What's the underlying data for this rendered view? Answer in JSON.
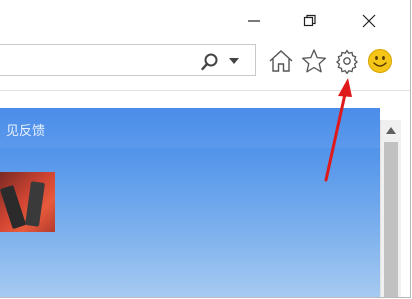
{
  "window": {
    "controls": [
      {
        "name": "minimize-icon"
      },
      {
        "name": "restore-icon"
      },
      {
        "name": "close-icon"
      }
    ]
  },
  "addressbar": {
    "icons": [
      "search-icon",
      "dropdown-caret-icon"
    ]
  },
  "toolbar": {
    "icons": [
      "home-icon",
      "favorites-star-icon",
      "settings-gear-icon",
      "feedback-smiley-icon"
    ],
    "smiley_color": "#f5c518"
  },
  "content": {
    "banner_text": "见反馈",
    "accent": "#3f86e9"
  },
  "annotation": {
    "arrow_color": "#e0191b"
  }
}
